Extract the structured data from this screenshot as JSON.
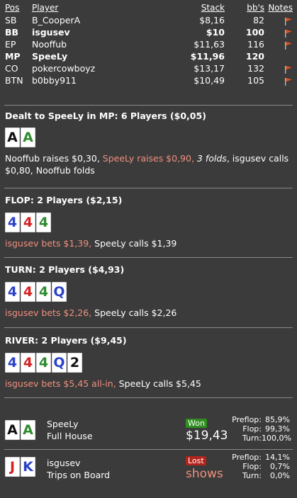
{
  "columns": {
    "pos": "Pos",
    "player": "Player",
    "stack": "Stack",
    "bbs": "bb's",
    "notes": "Notes"
  },
  "players": [
    {
      "pos": "SB",
      "name": "B_CooperA",
      "stack": "$8,16",
      "bbs": "82",
      "flag": true,
      "bold": false
    },
    {
      "pos": "BB",
      "name": "isgusev",
      "stack": "$10",
      "bbs": "100",
      "flag": true,
      "bold": true
    },
    {
      "pos": "EP",
      "name": "Nooffub",
      "stack": "$11,63",
      "bbs": "116",
      "flag": true,
      "bold": false
    },
    {
      "pos": "MP",
      "name": "SpeeLy",
      "stack": "$11,96",
      "bbs": "120",
      "flag": false,
      "bold": true
    },
    {
      "pos": "CO",
      "name": "pokercowboyz",
      "stack": "$13,17",
      "bbs": "132",
      "flag": true,
      "bold": false
    },
    {
      "pos": "BTN",
      "name": "b0bby911",
      "stack": "$10,49",
      "bbs": "105",
      "flag": true,
      "bold": false
    }
  ],
  "preflop": {
    "heading": "Dealt to SpeeLy in MP: 6 Players ($0,05)",
    "cards": [
      {
        "rank": "A",
        "suit": "spade"
      },
      {
        "rank": "A",
        "suit": "club"
      }
    ],
    "action_1": "Nooffub raises $0,30, ",
    "action_2": "SpeeLy raises $0,90, ",
    "action_3": "3 folds",
    "action_4": ", isgusev calls $0,80, Nooffub folds"
  },
  "flop": {
    "heading": "FLOP: 2 Players ($2,15)",
    "cards": [
      {
        "rank": "4",
        "suit": "diamond"
      },
      {
        "rank": "4",
        "suit": "heart"
      },
      {
        "rank": "4",
        "suit": "club"
      }
    ],
    "action_hi": "isgusev bets $1,39, ",
    "action_rest": "SpeeLy calls $1,39"
  },
  "turn": {
    "heading": "TURN: 2 Players ($4,93)",
    "cards": [
      {
        "rank": "4",
        "suit": "diamond"
      },
      {
        "rank": "4",
        "suit": "heart"
      },
      {
        "rank": "4",
        "suit": "club"
      },
      {
        "rank": "Q",
        "suit": "diamond"
      }
    ],
    "action_hi": "isgusev bets $2,26, ",
    "action_rest": "SpeeLy calls $2,26"
  },
  "river": {
    "heading": "RIVER: 2 Players ($9,45)",
    "cards": [
      {
        "rank": "4",
        "suit": "diamond"
      },
      {
        "rank": "4",
        "suit": "heart"
      },
      {
        "rank": "4",
        "suit": "club"
      },
      {
        "rank": "Q",
        "suit": "diamond"
      },
      {
        "rank": "2",
        "suit": "spade"
      }
    ],
    "action_hi": "isgusev bets $5,45 all-in, ",
    "action_rest": "SpeeLy calls $5,45"
  },
  "results": [
    {
      "name": "SpeeLy",
      "hand": "Full House",
      "cards": [
        {
          "rank": "A",
          "suit": "spade"
        },
        {
          "rank": "A",
          "suit": "club"
        }
      ],
      "badge": "Won",
      "badge_type": "won",
      "amount": "$19,43",
      "stats": [
        {
          "label": "Preflop:",
          "value": "85,9%"
        },
        {
          "label": "Flop:",
          "value": "99,3%"
        },
        {
          "label": "Turn:",
          "value": "100,0%"
        }
      ]
    },
    {
      "name": "isgusev",
      "hand": "Trips on Board",
      "cards": [
        {
          "rank": "J",
          "suit": "heart"
        },
        {
          "rank": "K",
          "suit": "diamond"
        }
      ],
      "badge": "Lost",
      "badge_type": "lost",
      "amount": "shows",
      "stats": [
        {
          "label": "Preflop:",
          "value": "14,1%"
        },
        {
          "label": "Flop:",
          "value": "0,7%"
        },
        {
          "label": "Turn:",
          "value": "0,0%"
        }
      ]
    }
  ],
  "colors": {
    "background": "#3b3b3b",
    "highlight": "#f0907e",
    "flag": "#d9531e",
    "won": "#2f8f1f",
    "lost": "#b3231c",
    "club": "#2e8b2e",
    "diamond": "#2a42c9",
    "heart": "#d62020",
    "spade": "#111111"
  }
}
